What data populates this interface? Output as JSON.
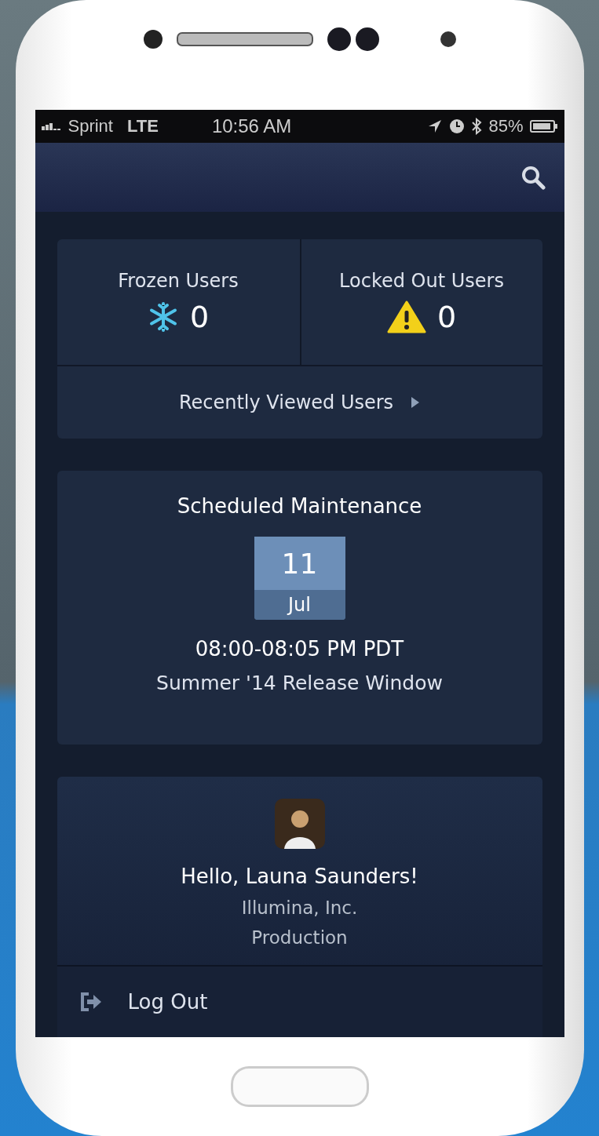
{
  "status_bar": {
    "carrier": "Sprint",
    "network": "LTE",
    "time": "10:56 AM",
    "battery": "85%"
  },
  "stats": [
    {
      "label": "Frozen Users",
      "count": "0",
      "kind": "frozen"
    },
    {
      "label": "Locked Out Users",
      "count": "0",
      "kind": "locked"
    }
  ],
  "recent_link": {
    "label": "Recently Viewed Users"
  },
  "maintenance": {
    "title": "Scheduled Maintenance",
    "day": "11",
    "month": "Jul",
    "time": "08:00-08:05 PM PDT",
    "name": "Summer '14 Release Window"
  },
  "profile": {
    "greeting": "Hello, Launa Saunders!",
    "company": "Illumina, Inc.",
    "org": "Production"
  },
  "menu": [
    {
      "label": "Log Out",
      "kind": "logout"
    }
  ]
}
